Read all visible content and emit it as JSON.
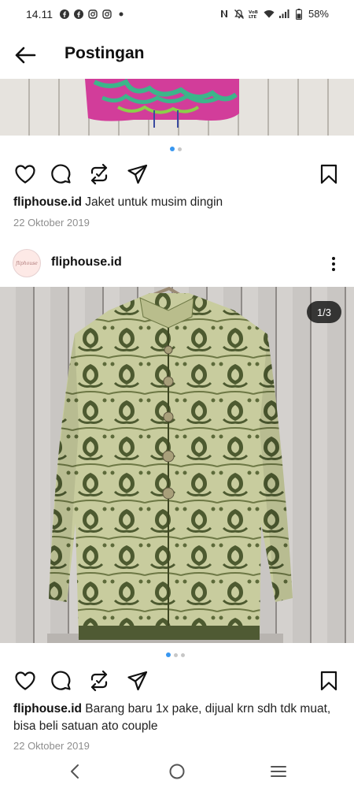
{
  "status_bar": {
    "time": "14.11",
    "left_icons": [
      "facebook-icon",
      "facebook-icon",
      "instagram-icon",
      "instagram-icon",
      "dot-icon"
    ],
    "right_icons": [
      "nfc-icon",
      "mute-icon",
      "volte-icon",
      "wifi-icon",
      "signal-icon",
      "battery-icon"
    ],
    "battery": "58%"
  },
  "header": {
    "back_icon": "arrow-left-icon",
    "title": "Postingan"
  },
  "post1": {
    "dots": 2,
    "active_dot": 0,
    "caption_user": "fliphouse.id",
    "caption_text": "Jaket untuk musim dingin",
    "date": "22 Oktober 2019"
  },
  "post2": {
    "username": "fliphouse.id",
    "avatar_text": "fliphouse",
    "counter": "1/3",
    "dots": 3,
    "active_dot": 0,
    "caption_user": "fliphouse.id",
    "caption_text": "Barang baru 1x pake,  dijual krn sdh tdk muat,  bisa beli satuan ato couple",
    "date": "22 Oktober 2019"
  },
  "actions": [
    "heart-icon",
    "comment-icon",
    "repost-icon",
    "share-icon",
    "bookmark-icon"
  ],
  "nav": [
    "back-icon",
    "home-icon",
    "recents-icon"
  ],
  "colors": {
    "accent_dot": "#3897f0",
    "text": "#111111",
    "muted": "#8e8e8e"
  }
}
